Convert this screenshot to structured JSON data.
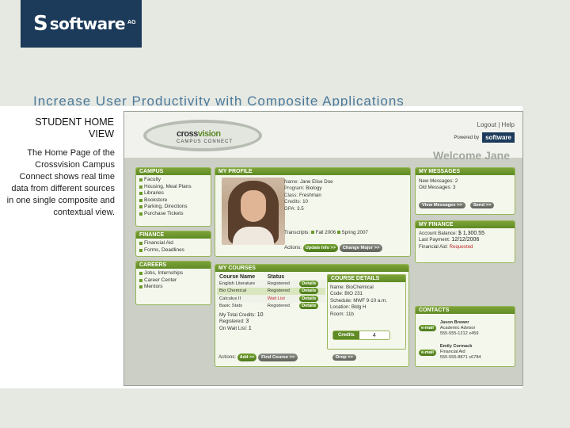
{
  "logo": {
    "text": "software",
    "suffix": "AG"
  },
  "slide_title": "Increase User Productivity with Composite Applications",
  "sidebar": {
    "heading": "STUDENT HOME VIEW",
    "description": "The Home Page of the Crossvision Campus Connect shows real time data from different sources in one single composite and contextual view."
  },
  "app": {
    "brand": {
      "name_a": "cross",
      "name_b": "vision",
      "sub": "Campus Connect"
    },
    "links": {
      "logout": "Logout",
      "sep": "|",
      "help": "Help"
    },
    "powered": {
      "label": "Powered by",
      "logo": "software"
    },
    "welcome": "Welcome Jane",
    "campus": {
      "title": "Campus",
      "items": [
        "Faculty",
        "Housing, Meal Plans",
        "Libraries",
        "Bookstore",
        "Parking, Directions",
        "Purchase Tickets"
      ]
    },
    "finance_nav": {
      "title": "Finance",
      "items": [
        "Financial Aid",
        "Forms, Deadlines"
      ]
    },
    "careers": {
      "title": "Careers",
      "items": [
        "Jobs, Internships",
        "Career Center",
        "Mentors"
      ]
    },
    "profile": {
      "title": "My Profile",
      "name_k": "Name:",
      "name_v": "Jane Elise Doe",
      "program_k": "Program:",
      "program_v": "Biology",
      "class_k": "Class:",
      "class_v": "Freshman",
      "credits_k": "Credits:",
      "credits_v": "10",
      "gpa_k": "GPA:",
      "gpa_v": "3.5",
      "transcripts": "Transcripts:",
      "fall": "Fall 2006",
      "spring": "Spring 2007",
      "actions": "Actions:",
      "update": "Update Info >>",
      "change": "Change Major >>"
    },
    "messages": {
      "title": "My Messages",
      "new_k": "New Messages:",
      "new_v": "2",
      "old_k": "Old Messages:",
      "old_v": "3",
      "view": "View Messages >>",
      "send": "Send >>"
    },
    "finance": {
      "title": "My Finance",
      "balance_k": "Account Balance:",
      "balance_v": "$ 1,300.55",
      "last_k": "Last Payment:",
      "last_v": "12/12/2006",
      "aid_k": "Financial Aid:",
      "aid_v": "Requested"
    },
    "courses": {
      "title": "My Courses",
      "col_name": "Course Name",
      "col_status": "Status",
      "rows": [
        {
          "name": "English Literature",
          "status": "Registered",
          "btn": "Details"
        },
        {
          "name": "Bio Chemical",
          "status": "Registered",
          "btn": "Details"
        },
        {
          "name": "Calculus II",
          "status": "Wait List",
          "btn": "Details"
        },
        {
          "name": "Basic Stats",
          "status": "Registered",
          "btn": "Details"
        }
      ],
      "total_k": "My Total Credits:",
      "total_v": "10",
      "reg_k": "Registered:",
      "reg_v": "3",
      "wait_k": "On Wait List:",
      "wait_v": "1",
      "actions": "Actions:",
      "add": "Add >>",
      "find": "Find Course >>"
    },
    "details": {
      "title": "Course Details",
      "name_k": "Name:",
      "name_v": "BioChemical",
      "code_k": "Code:",
      "code_v": "BIO 231",
      "sched_k": "Schedule:",
      "sched_v": "MWF 9-10 a.m.",
      "loc_k": "Location:",
      "loc_v": "Bldg H",
      "room_k": "Room:",
      "room_v": "11b",
      "credits_lbl": "Credits",
      "credits_v": "4",
      "drop": "Drop >>"
    },
    "contacts": {
      "title": "Contacts",
      "items": [
        {
          "btn": "e-mail",
          "name": "Jason Brewer",
          "role": "Academic Advisor",
          "phone": "555-555-1212 x459"
        },
        {
          "btn": "e-mail",
          "name": "Emily Cormack",
          "role": "Financial Aid",
          "phone": "555-555-8871 x6784"
        }
      ]
    }
  }
}
